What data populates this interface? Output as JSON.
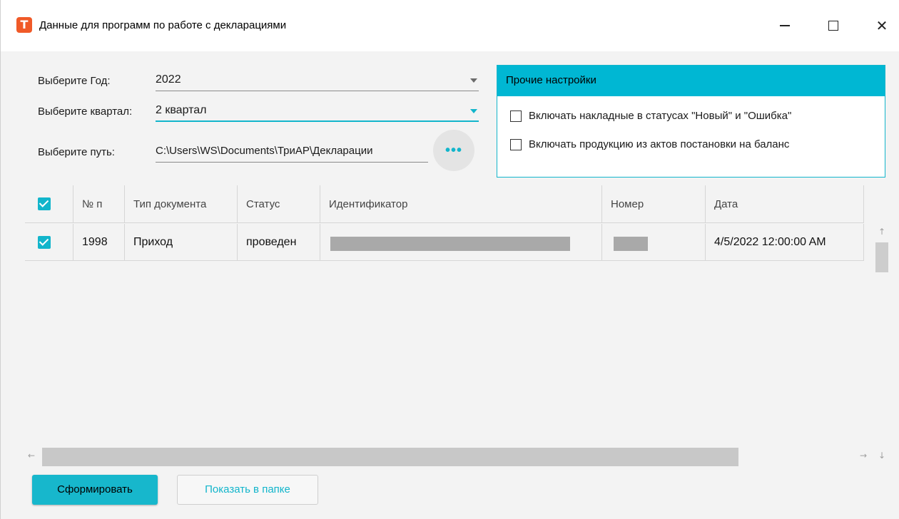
{
  "window": {
    "title": "Данные для программ по работе с декларациями",
    "logo_letter": "T",
    "logo_color": "#f05a28"
  },
  "form": {
    "year_label": "Выберите Год:",
    "year_value": "2022",
    "quarter_label": "Выберите квартал:",
    "quarter_value": "2 квартал",
    "path_label": "Выберите путь:",
    "path_value": "C:\\Users\\WS\\Documents\\ТриАР\\Декларации",
    "browse_label": "•••"
  },
  "settings": {
    "title": "Прочие настройки",
    "options": [
      {
        "label": "Включать накладные в статусах \"Новый\" и \"Ошибка\"",
        "checked": false
      },
      {
        "label": "Включать продукцию из актов постановки на баланс",
        "checked": false
      }
    ]
  },
  "grid": {
    "columns": [
      "№ п",
      "Тип документа",
      "Статус",
      "Идентификатор",
      "Номер",
      "Дата"
    ],
    "rows": [
      {
        "checked": true,
        "num": "1998",
        "type": "Приход",
        "status": "проведен",
        "date": "4/5/2022 12:00:00 AM"
      }
    ]
  },
  "buttons": {
    "generate": "Сформировать",
    "show_in_folder": "Показать в папке"
  },
  "colors": {
    "accent": "#12b5cb",
    "settings_header": "#00b7d3"
  }
}
